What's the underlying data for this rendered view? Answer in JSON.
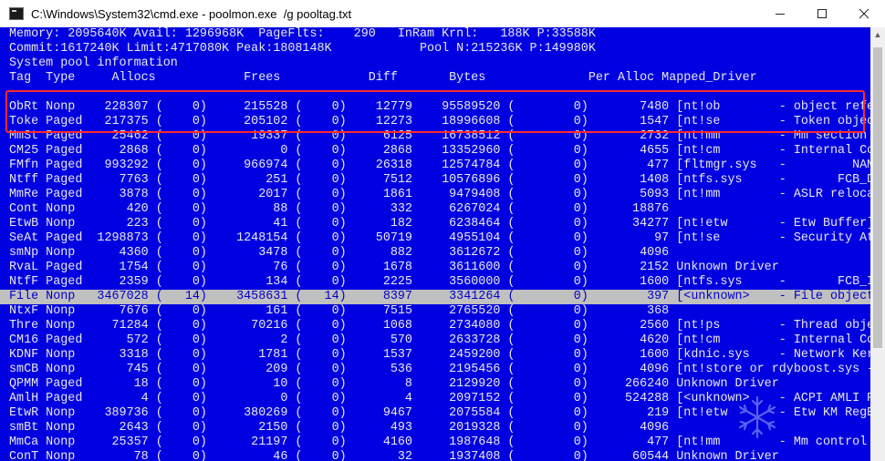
{
  "window": {
    "title": "C:\\Windows\\System32\\cmd.exe - poolmon.exe  /g pooltag.txt",
    "minimize_icon": "minimize-icon",
    "maximize_icon": "maximize-icon",
    "close_icon": "close-icon"
  },
  "console": {
    "header": [
      "Memory: 2095640K Avail: 1296968K  PageFlts:    290   InRam Krnl:   188K P:33588K",
      "Commit:1617240K Limit:4717080K Peak:1808148K            Pool N:215236K P:149980K",
      "System pool information",
      "Tag  Type     Allocs            Frees            Diff       Bytes              Per Alloc Mapped_Driver"
    ],
    "rows": [
      "",
      "ObRt Nonp    228307 (    0)     215528 (    0)    12779    95589520 (        0)       7480 [nt!ob        - object refe",
      "Toke Paged   217375 (    0)     205102 (    0)    12273    18996608 (        0)       1547 [nt!se        - Token objec",
      "MmSt Paged    25462 (    0)      19337 (    0)     6125    16738512 (        0)       2732 [nt!mm        - Mm section",
      "CM25 Paged     2868 (    0)          0 (    0)     2868    13352960 (        0)       4655 [nt!cm        - Internal Co",
      "FMfn Paged   993292 (    0)     966974 (    0)    26318    12574784 (        0)        477 [fltmgr.sys   -         NAME_",
      "Ntff Paged     7763 (    0)        251 (    0)     7512    10576896 (        0)       1408 [ntfs.sys     -       FCB_DAT",
      "MmRe Paged     3878 (    0)       2017 (    0)     1861     9479408 (        0)       5093 [nt!mm        - ASLR reloca",
      "Cont Nonp       420 (    0)         88 (    0)      332     6267024 (        0)      18876",
      "EtwB Nonp       223 (    0)         41 (    0)      182     6238464 (        0)      34277 [nt!etw       - Etw Buffer]",
      "SeAt Paged  1298873 (    0)    1248154 (    0)    50719     4955104 (        0)         97 [nt!se        - Security At",
      "smNp Nonp      4360 (    0)       3478 (    0)      882     3612672 (        0)       4096",
      "RvaL Paged     1754 (    0)         76 (    0)     1678     3611600 (        0)       2152 Unknown Driver",
      "NtfF Paged     2359 (    0)        134 (    0)     2225     3560000 (        0)       1600 [ntfs.sys     -       FCB_IND",
      "File Nonp   3467028 (   14)    3458631 (   14)     8397     3341264 (        0)        397 [<unknown>    - File object",
      "NtxF Nonp      7676 (    0)        161 (    0)     7515     2765520 (        0)        368",
      "Thre Nonp     71284 (    0)      70216 (    0)     1068     2734080 (        0)       2560 [nt!ps        - Thread obje",
      "CM16 Paged      572 (    0)          2 (    0)      570     2633728 (        0)       4620 [nt!cm        - Internal Co",
      "KDNF Nonp      3318 (    0)       1781 (    0)     1537     2459200 (        0)       1600 [kdnic.sys    - Network Ker",
      "smCB Nonp       745 (    0)        209 (    0)      536     2195456 (        0)       4096 [nt!store or rdyboost.sys -",
      "QPMM Paged       18 (    0)         10 (    0)        8     2129920 (        0)     266240 Unknown Driver",
      "AmlH Paged        4 (    0)          0 (    0)        4     2097152 (        0)     524288 [<unknown>    - ACPI AMLI P",
      "EtwR Nonp    389736 (    0)     380269 (    0)     9467     2075584 (        0)        219 [nt!etw       - Etw KM RegE",
      "smBt Nonp      2643 (    0)       2150 (    0)      493     2019328 (        0)       4096",
      "MmCa Nonp     25357 (    0)      21197 (    0)     4160     1987648 (        0)        477 [nt!mm        - Mm control",
      "ConT Nonp        78 (    0)         46 (    0)       32     1937408 (        0)      60544 Unknown Driver"
    ],
    "selected_row_index": 13
  },
  "colors": {
    "console_bg": "#0000e0",
    "console_text": "#e8e8e8",
    "selected_bg": "#c0c0c0",
    "selected_text": "#0000c8",
    "highlight_border": "#ff2a2a"
  }
}
